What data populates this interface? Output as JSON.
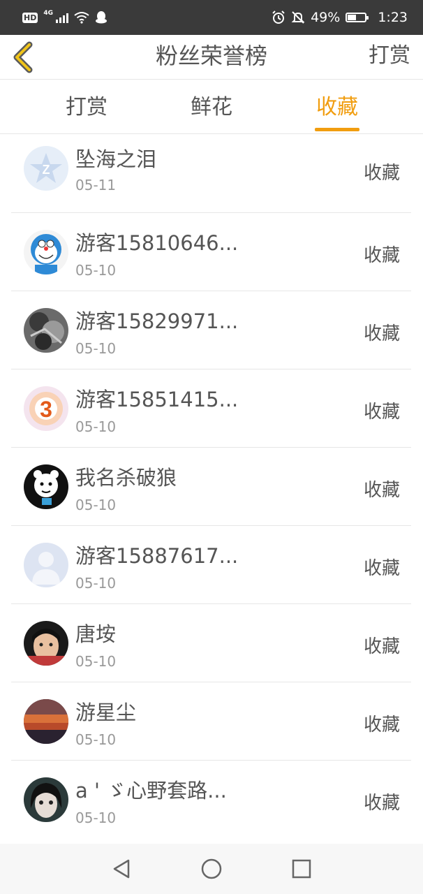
{
  "status": {
    "hd": "HD",
    "network": "4G",
    "battery": "49%",
    "time": "1:23"
  },
  "header": {
    "title": "粉丝荣誉榜",
    "action": "打赏"
  },
  "tabs": [
    {
      "label": "打赏"
    },
    {
      "label": "鲜花"
    },
    {
      "label": "收藏",
      "active": true
    }
  ],
  "items": [
    {
      "name": "坠海之泪",
      "date": "05-11",
      "action": "收藏"
    },
    {
      "name": "游客15810646...",
      "date": "05-10",
      "action": "收藏"
    },
    {
      "name": "游客15829971...",
      "date": "05-10",
      "action": "收藏"
    },
    {
      "name": "游客15851415...",
      "date": "05-10",
      "action": "收藏"
    },
    {
      "name": "我名杀破狼",
      "date": "05-10",
      "action": "收藏"
    },
    {
      "name": "游客15887617...",
      "date": "05-10",
      "action": "收藏"
    },
    {
      "name": "唐垵",
      "date": "05-10",
      "action": "收藏"
    },
    {
      "name": "游星尘",
      "date": "05-10",
      "action": "收藏"
    },
    {
      "name": "a ' ゞ心野套路...",
      "date": "05-10",
      "action": "收藏"
    }
  ],
  "colors": {
    "accent": "#f19d0f",
    "statusbar": "#3a3a3a",
    "text": "#555555",
    "subtext": "#999999"
  }
}
